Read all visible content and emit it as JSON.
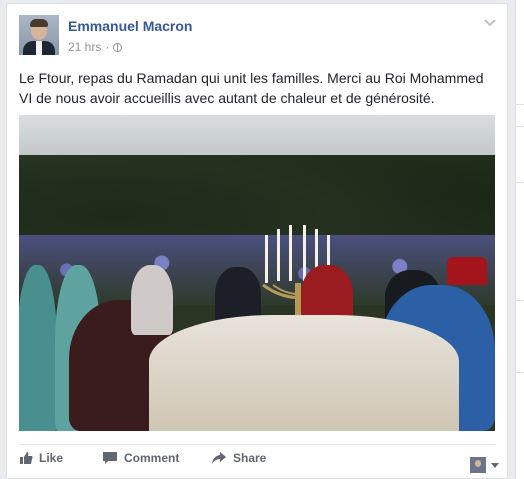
{
  "post": {
    "author": "Emmanuel Macron",
    "time": "21 hrs",
    "separator": "·",
    "text": "Le Ftour, repas du Ramadan qui unit les familles. Merci au Roi Mohammed VI de nous avoir accueillis avec autant de chaleur et de générosité."
  },
  "actions": {
    "like": "Like",
    "comment": "Comment",
    "share": "Share"
  },
  "icons": {
    "audience": "globe-icon",
    "options": "chevron-down-icon",
    "like": "thumbs-up-icon",
    "comment": "comment-bubble-icon",
    "share": "share-arrow-icon"
  },
  "colors": {
    "author_link": "#365899",
    "meta": "#90949c",
    "text": "#1d2129",
    "action": "#606770"
  }
}
